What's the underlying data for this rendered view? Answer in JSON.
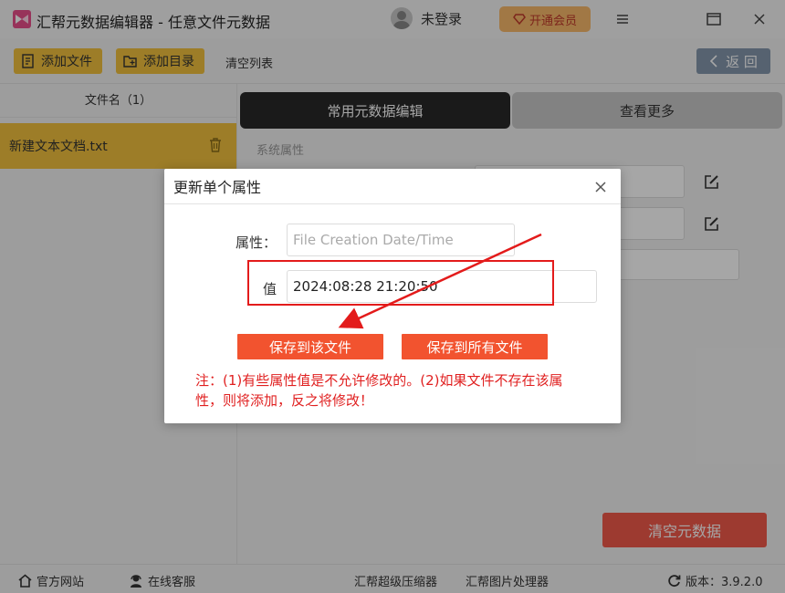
{
  "titlebar": {
    "title": "汇帮元数据编辑器 - 任意文件元数据",
    "login_text": "未登录",
    "vip_label": "开通会员"
  },
  "toolbar": {
    "add_file": "添加文件",
    "add_dir": "添加目录",
    "clear_list": "清空列表",
    "back": "返 回"
  },
  "left_panel": {
    "header": "文件名（1）",
    "files": [
      "新建文本文档.txt"
    ]
  },
  "right_panel": {
    "tab_common": "常用元数据编辑",
    "tab_more": "查看更多",
    "section_label": "系统属性",
    "clear_button": "清空元数据"
  },
  "dialog": {
    "title": "更新单个属性",
    "attr_label": "属性：",
    "attr_placeholder": "File Creation Date/Time",
    "value_label": "值",
    "value": "2024:08:28 21:20:50",
    "save_this": "保存到该文件",
    "save_all": "保存到所有文件",
    "note": "注：(1)有些属性值是不允许修改的。(2)如果文件不存在该属性，则将添加，反之将修改！"
  },
  "statusbar": {
    "website": "官方网站",
    "support": "在线客服",
    "compressor": "汇帮超级压缩器",
    "image_tool": "汇帮图片处理器",
    "version": "版本：3.9.2.0"
  },
  "colors": {
    "accent_yellow": "#f1c13e",
    "dialog_button": "#f2532f",
    "highlight": "#e31b1b"
  }
}
